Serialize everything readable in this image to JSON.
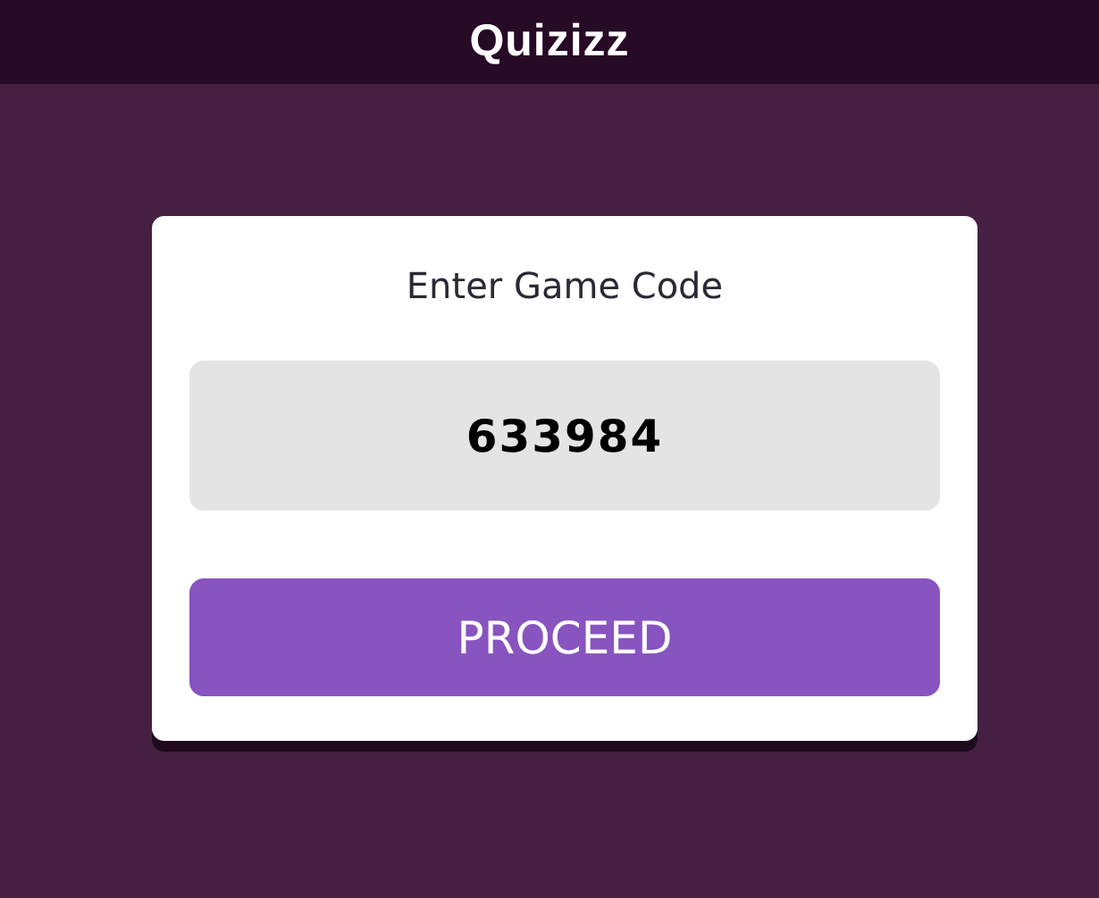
{
  "header": {
    "logo": "Quizizz"
  },
  "card": {
    "title": "Enter Game Code",
    "code_field": {
      "value": "633984"
    },
    "button": "PROCEED"
  }
}
